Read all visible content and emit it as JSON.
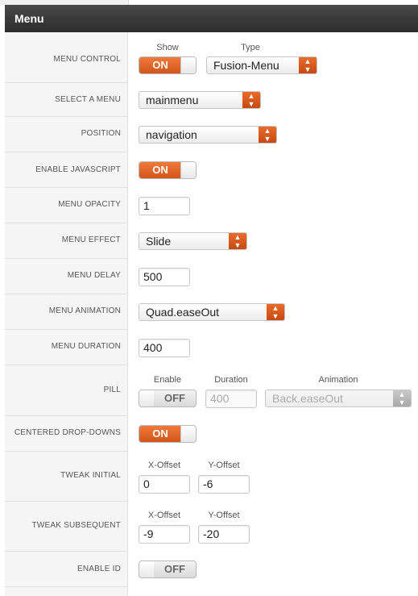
{
  "panel": {
    "title": "Menu"
  },
  "rows": {
    "menu_control": {
      "label": "MENU CONTROL",
      "show_header": "Show",
      "type_header": "Type",
      "show_value": "ON",
      "type_value": "Fusion-Menu"
    },
    "select_menu": {
      "label": "SELECT A MENU",
      "value": "mainmenu"
    },
    "position": {
      "label": "POSITION",
      "value": "navigation"
    },
    "enable_js": {
      "label": "ENABLE JAVASCRIPT",
      "value": "ON"
    },
    "opacity": {
      "label": "MENU OPACITY",
      "value": "1"
    },
    "effect": {
      "label": "MENU EFFECT",
      "value": "Slide"
    },
    "delay": {
      "label": "MENU DELAY",
      "value": "500"
    },
    "animation": {
      "label": "MENU ANIMATION",
      "value": "Quad.easeOut"
    },
    "duration": {
      "label": "MENU DURATION",
      "value": "400"
    },
    "pill": {
      "label": "PILL",
      "enable_header": "Enable",
      "duration_header": "Duration",
      "animation_header": "Animation",
      "enable_value": "OFF",
      "duration_value": "400",
      "animation_value": "Back.easeOut"
    },
    "centered": {
      "label": "CENTERED DROP-DOWNS",
      "value": "ON"
    },
    "tweak_initial": {
      "label": "TWEAK INITIAL",
      "x_header": "X-Offset",
      "y_header": "Y-Offset",
      "x_value": "0",
      "y_value": "-6"
    },
    "tweak_subsequent": {
      "label": "TWEAK SUBSEQUENT",
      "x_header": "X-Offset",
      "y_header": "Y-Offset",
      "x_value": "-9",
      "y_value": "-20"
    },
    "enable_id": {
      "label": "ENABLE ID",
      "value": "OFF"
    }
  },
  "colors": {
    "accent": "#dd5f22",
    "header_bg": "#333333",
    "label_col_bg": "#f5f5f5"
  }
}
